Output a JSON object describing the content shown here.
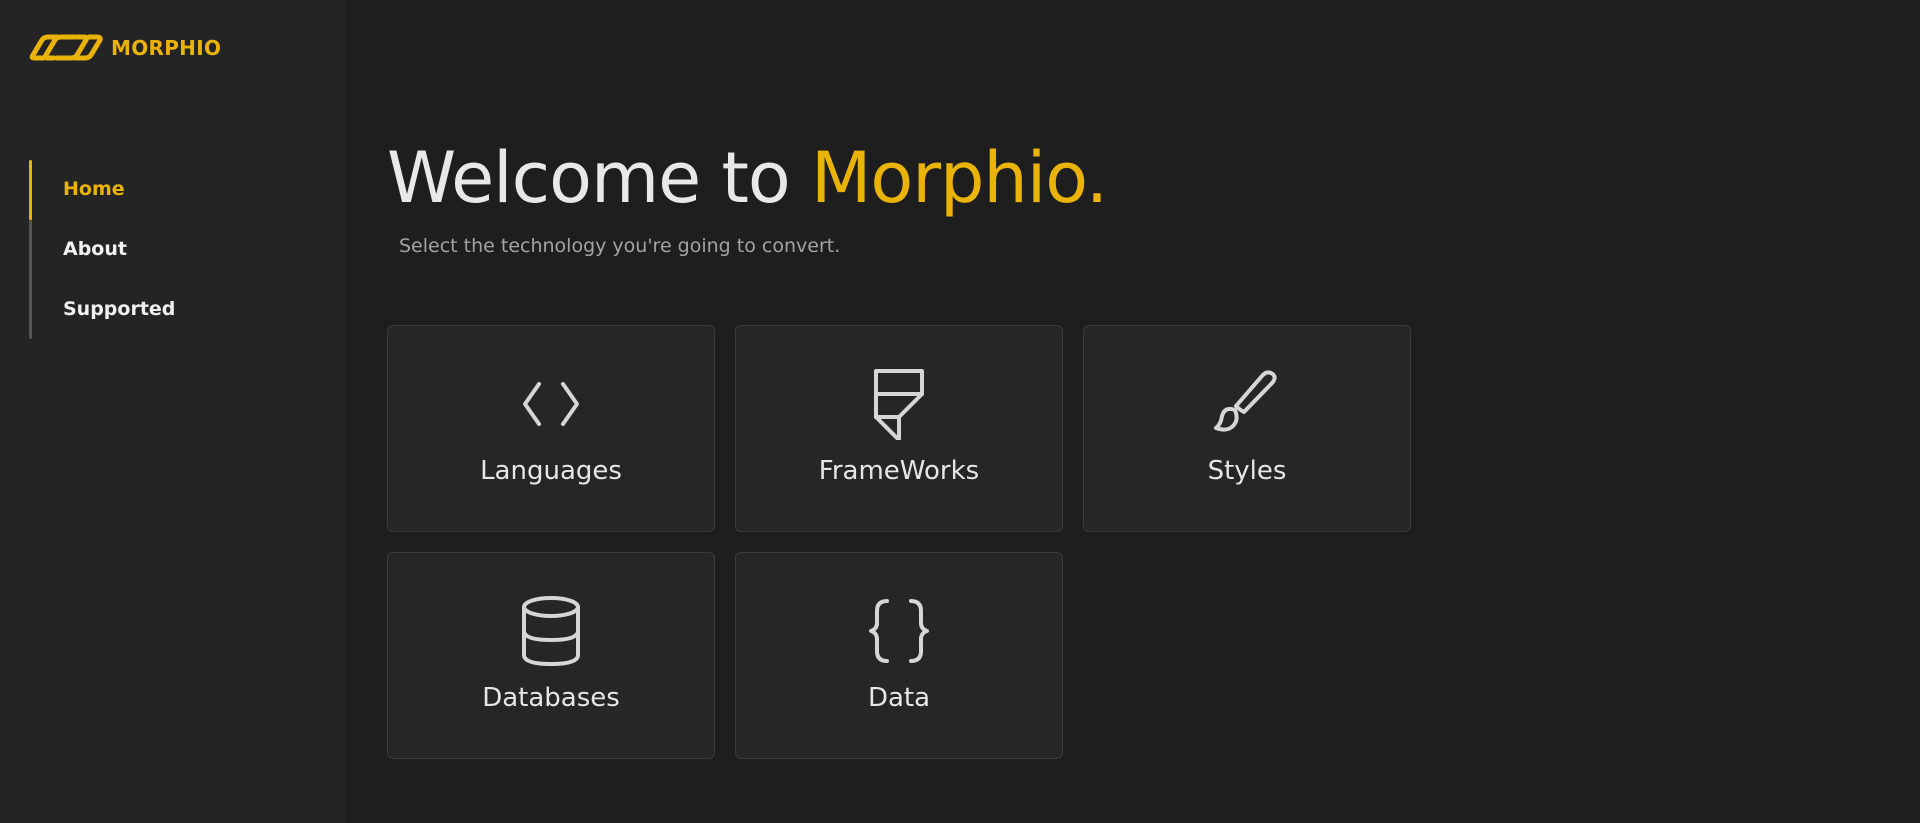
{
  "brand": {
    "name": "MORPHIO",
    "accent_color": "#eab308",
    "logo_icon": "infinity-links-icon"
  },
  "nav": {
    "items": [
      {
        "label": "Home",
        "active": true
      },
      {
        "label": "About",
        "active": false
      },
      {
        "label": "Supported",
        "active": false
      }
    ]
  },
  "hero": {
    "title_prefix": "Welcome to ",
    "title_brand": "Morphio.",
    "subtitle": "Select the technology you're going to convert."
  },
  "cards": [
    {
      "label": "Languages",
      "icon": "code-brackets-icon"
    },
    {
      "label": "FrameWorks",
      "icon": "framer-logo-icon"
    },
    {
      "label": "Styles",
      "icon": "paint-brush-icon"
    },
    {
      "label": "Databases",
      "icon": "database-icon"
    },
    {
      "label": "Data",
      "icon": "curly-braces-icon"
    }
  ]
}
